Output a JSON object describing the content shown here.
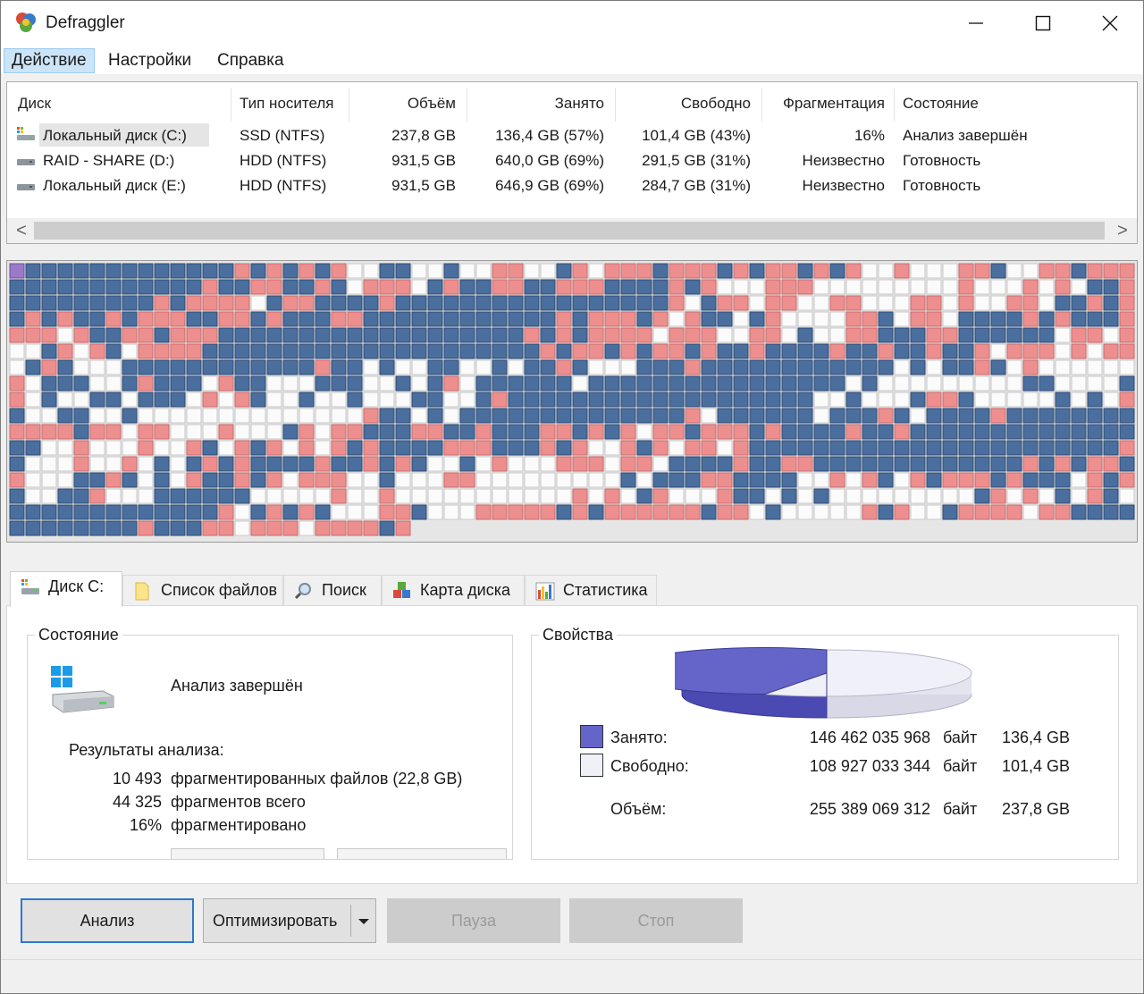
{
  "window": {
    "title": "Defraggler",
    "minimize": "—",
    "maximize": "☐",
    "close": "✕"
  },
  "menu": [
    "Действие",
    "Настройки",
    "Справка"
  ],
  "drives": {
    "columns": [
      "Диск",
      "Тип носителя",
      "Объём",
      "Занято",
      "Свободно",
      "Фрагментация",
      "Состояние"
    ],
    "rows": [
      {
        "name": "Локальный диск (C:)",
        "type": "SSD (NTFS)",
        "size": "237,8 GB",
        "used": "136,4 GB (57%)",
        "free": "101,4 GB (43%)",
        "frag": "16%",
        "state": "Анализ завершён"
      },
      {
        "name": "RAID - SHARE (D:)",
        "type": "HDD (NTFS)",
        "size": "931,5 GB",
        "used": "640,0 GB (69%)",
        "free": "291,5 GB (31%)",
        "frag": "Неизвестно",
        "state": "Готовность"
      },
      {
        "name": "Локальный диск (E:)",
        "type": "HDD (NTFS)",
        "size": "931,5 GB",
        "used": "646,9 GB (69%)",
        "free": "284,7 GB (31%)",
        "frag": "Неизвестно",
        "state": "Готовность"
      }
    ],
    "scroll_left": "<",
    "scroll_right": ">"
  },
  "diskmap": {
    "colors": {
      "used": "#4a6f9e",
      "fragmented": "#ee8f8f",
      "free": "#fbfbfb",
      "system": "#9a7ac8"
    }
  },
  "tabs": [
    "Диск C:",
    "Список файлов",
    "Поиск",
    "Карта диска",
    "Статистика"
  ],
  "status": {
    "title": "Состояние",
    "state_text": "Анализ завершён",
    "results_label": "Результаты анализа:",
    "results": [
      {
        "value": "10 493",
        "label": "фрагментированных файлов (22,8 GB)"
      },
      {
        "value": "44 325",
        "label": "фрагментов всего"
      },
      {
        "value": "16%",
        "label": "фрагментировано"
      }
    ]
  },
  "properties": {
    "title": "Свойства",
    "used_label": "Занято:",
    "used_bytes": "146 462 035 968",
    "used_unit": "байт",
    "used_gb": "136,4 GB",
    "free_label": "Свободно:",
    "free_bytes": "108 927 033 344",
    "free_unit": "байт",
    "free_gb": "101,4 GB",
    "total_label": "Объём:",
    "total_bytes": "255 389 069 312",
    "total_unit": "байт",
    "total_gb": "237,8 GB",
    "used_fraction": 0.57,
    "used_color": "#6565c9",
    "free_color": "#f0f0f8"
  },
  "buttons": {
    "analyze": "Анализ",
    "optimize": "Оптимизировать",
    "pause": "Пауза",
    "stop": "Стоп"
  }
}
